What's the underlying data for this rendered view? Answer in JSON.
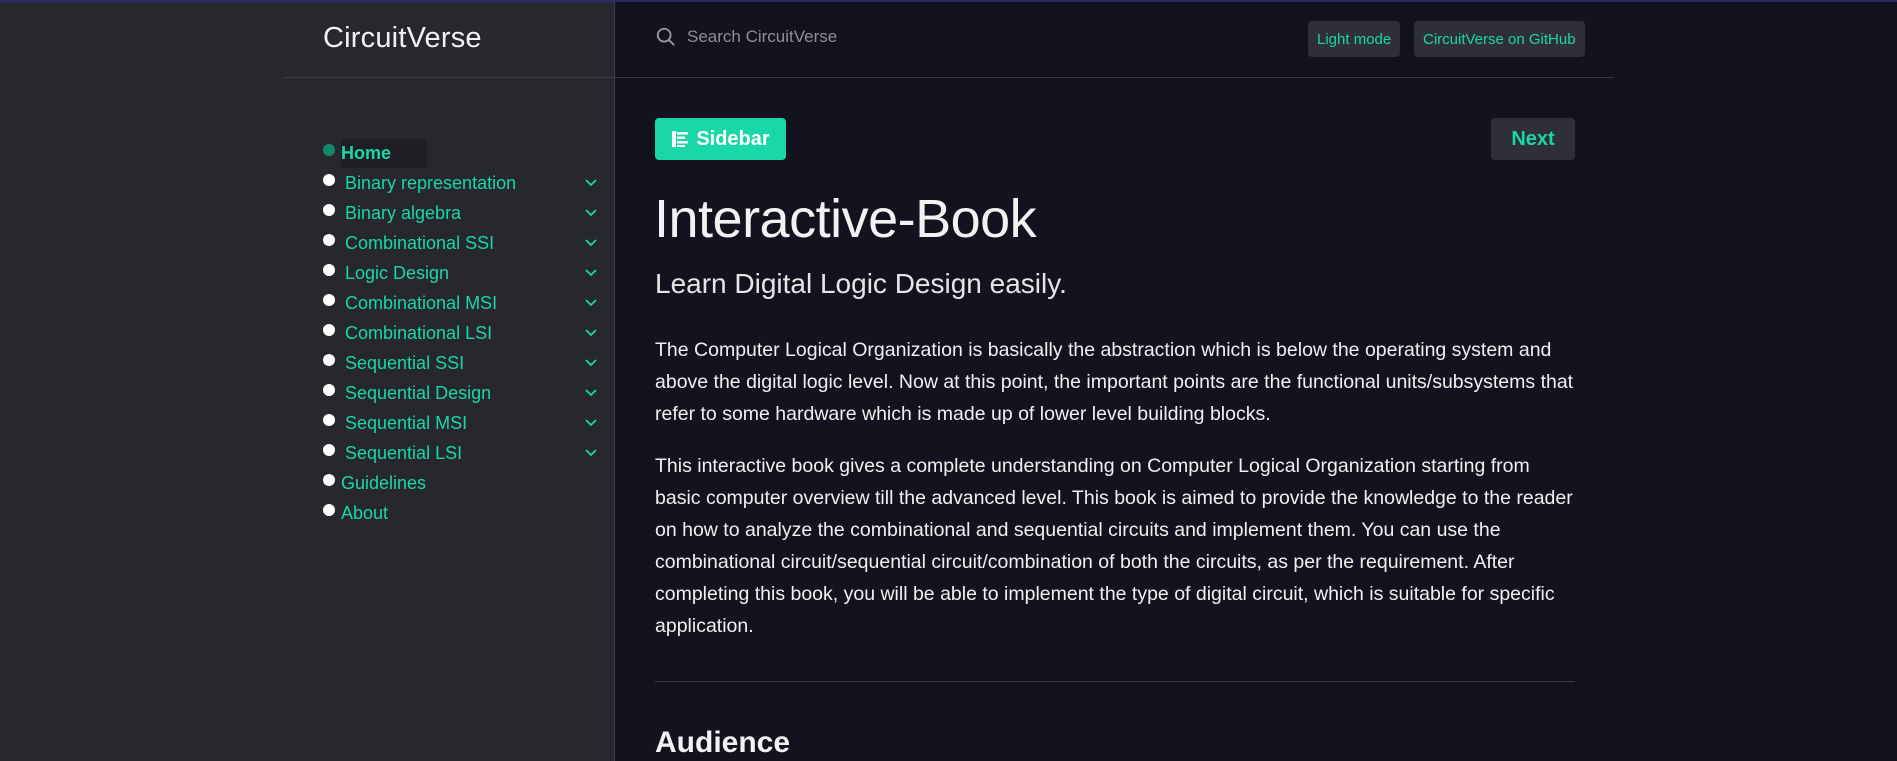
{
  "header": {
    "brand": "CircuitVerse",
    "search_placeholder": "Search CircuitVerse",
    "light_mode_label": "Light mode",
    "github_label": "CircuitVerse on GitHub"
  },
  "sidebar": {
    "items": [
      {
        "label": "Home",
        "active": true,
        "expandable": false
      },
      {
        "label": "Binary representation",
        "expandable": true
      },
      {
        "label": "Binary algebra",
        "expandable": true
      },
      {
        "label": "Combinational SSI",
        "expandable": true
      },
      {
        "label": "Logic Design",
        "expandable": true
      },
      {
        "label": "Combinational MSI",
        "expandable": true
      },
      {
        "label": "Combinational LSI",
        "expandable": true
      },
      {
        "label": "Sequential SSI",
        "expandable": true
      },
      {
        "label": "Sequential Design",
        "expandable": true
      },
      {
        "label": "Sequential MSI",
        "expandable": true
      },
      {
        "label": "Sequential LSI",
        "expandable": true
      },
      {
        "label": "Guidelines",
        "expandable": false
      },
      {
        "label": "About",
        "expandable": false
      }
    ]
  },
  "toolbar": {
    "sidebar_label": "Sidebar",
    "next_label": "Next"
  },
  "main": {
    "title": "Interactive-Book",
    "subtitle": "Learn Digital Logic Design easily.",
    "paragraph1": "The Computer Logical Organization is basically the abstraction which is below the operating system and above the digital logic level. Now at this point, the important points are the functional units/subsystems that refer to some hardware which is made up of lower level building blocks.",
    "paragraph2": "This interactive book gives a complete understanding on Computer Logical Organization starting from basic computer overview till the advanced level. This book is aimed to provide the knowledge to the reader on how to analyze the combinational and sequential circuits and implement them. You can use the combinational circuit/sequential circuit/combination of both the circuits, as per the requirement. After completing this book, you will be able to implement the type of digital circuit, which is suitable for specific application.",
    "section_heading": "Audience"
  },
  "colors": {
    "accent": "#19d7a6",
    "background": "#13131f",
    "sidebar_background": "#27272e"
  }
}
